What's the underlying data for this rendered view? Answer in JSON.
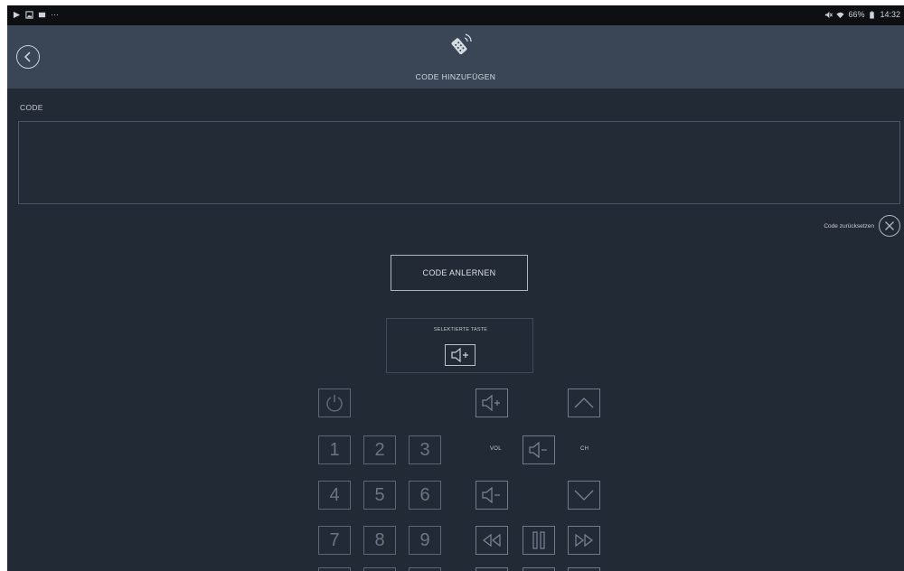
{
  "status_bar": {
    "left_icons": [
      "play-store-icon",
      "gallery-icon",
      "screenshot-icon",
      "more-notifications-icon"
    ],
    "more_text": "···",
    "right_text": "66%",
    "time": "14:32",
    "icons": [
      "mute-icon",
      "wifi-icon",
      "battery-icon"
    ]
  },
  "header": {
    "title": "CODE HINZUFÜGEN",
    "icon": "remote-control-icon",
    "back_icon": "back-arrow-icon"
  },
  "code": {
    "label": "CODE",
    "value": ""
  },
  "reset": {
    "label": "Code zurücksetzen",
    "icon": "close-circle-icon"
  },
  "learn_button": {
    "label": "CODE ANLERNEN"
  },
  "selected_key": {
    "label": "SELEKTIERTE TASTE",
    "icon": "volume-up-icon"
  },
  "keypad": {
    "numbers": [
      "1",
      "2",
      "3",
      "4",
      "5",
      "6",
      "7",
      "8",
      "9"
    ],
    "vol_label": "VOL",
    "ch_label": "CH"
  },
  "colors": {
    "background": "#222a36",
    "header": "#3a4656",
    "status_bar": "#0d0f12",
    "key_border": "#5b6677"
  }
}
